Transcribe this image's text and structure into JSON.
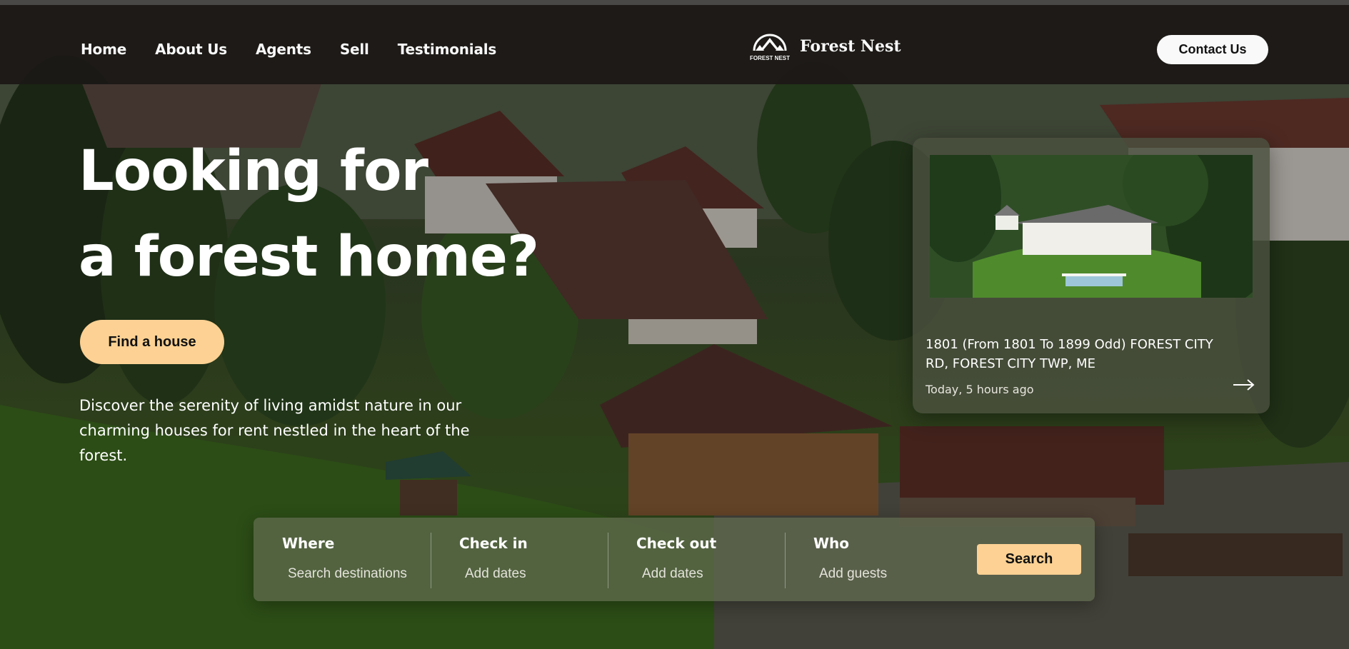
{
  "nav": {
    "links": [
      "Home",
      "About Us",
      "Agents",
      "Sell",
      "Testimonials"
    ],
    "brand_name": "Forest Nest",
    "logo_text": "FOREST NEST",
    "contact_label": "Contact Us"
  },
  "hero": {
    "headline_line1": "Looking for",
    "headline_line2": "a forest home?",
    "cta_label": "Find a house",
    "description": "Discover the serenity of living amidst nature in our charming houses for rent nestled in the heart of the forest."
  },
  "listing_card": {
    "address": "1801 (From 1801 To 1899 Odd) FOREST CITY RD, FOREST CITY TWP, ME",
    "time": "Today, 5 hours ago",
    "arrow_icon": "arrow-right-icon"
  },
  "search": {
    "fields": [
      {
        "label": "Where",
        "placeholder": "Search destinations"
      },
      {
        "label": "Check in",
        "placeholder": "Add dates"
      },
      {
        "label": "Check out",
        "placeholder": "Add dates"
      },
      {
        "label": "Who",
        "placeholder": "Add guests"
      }
    ],
    "button_label": "Search"
  },
  "colors": {
    "accent": "#fcd193",
    "navbar": "#1c1917",
    "text": "#ffffff"
  }
}
